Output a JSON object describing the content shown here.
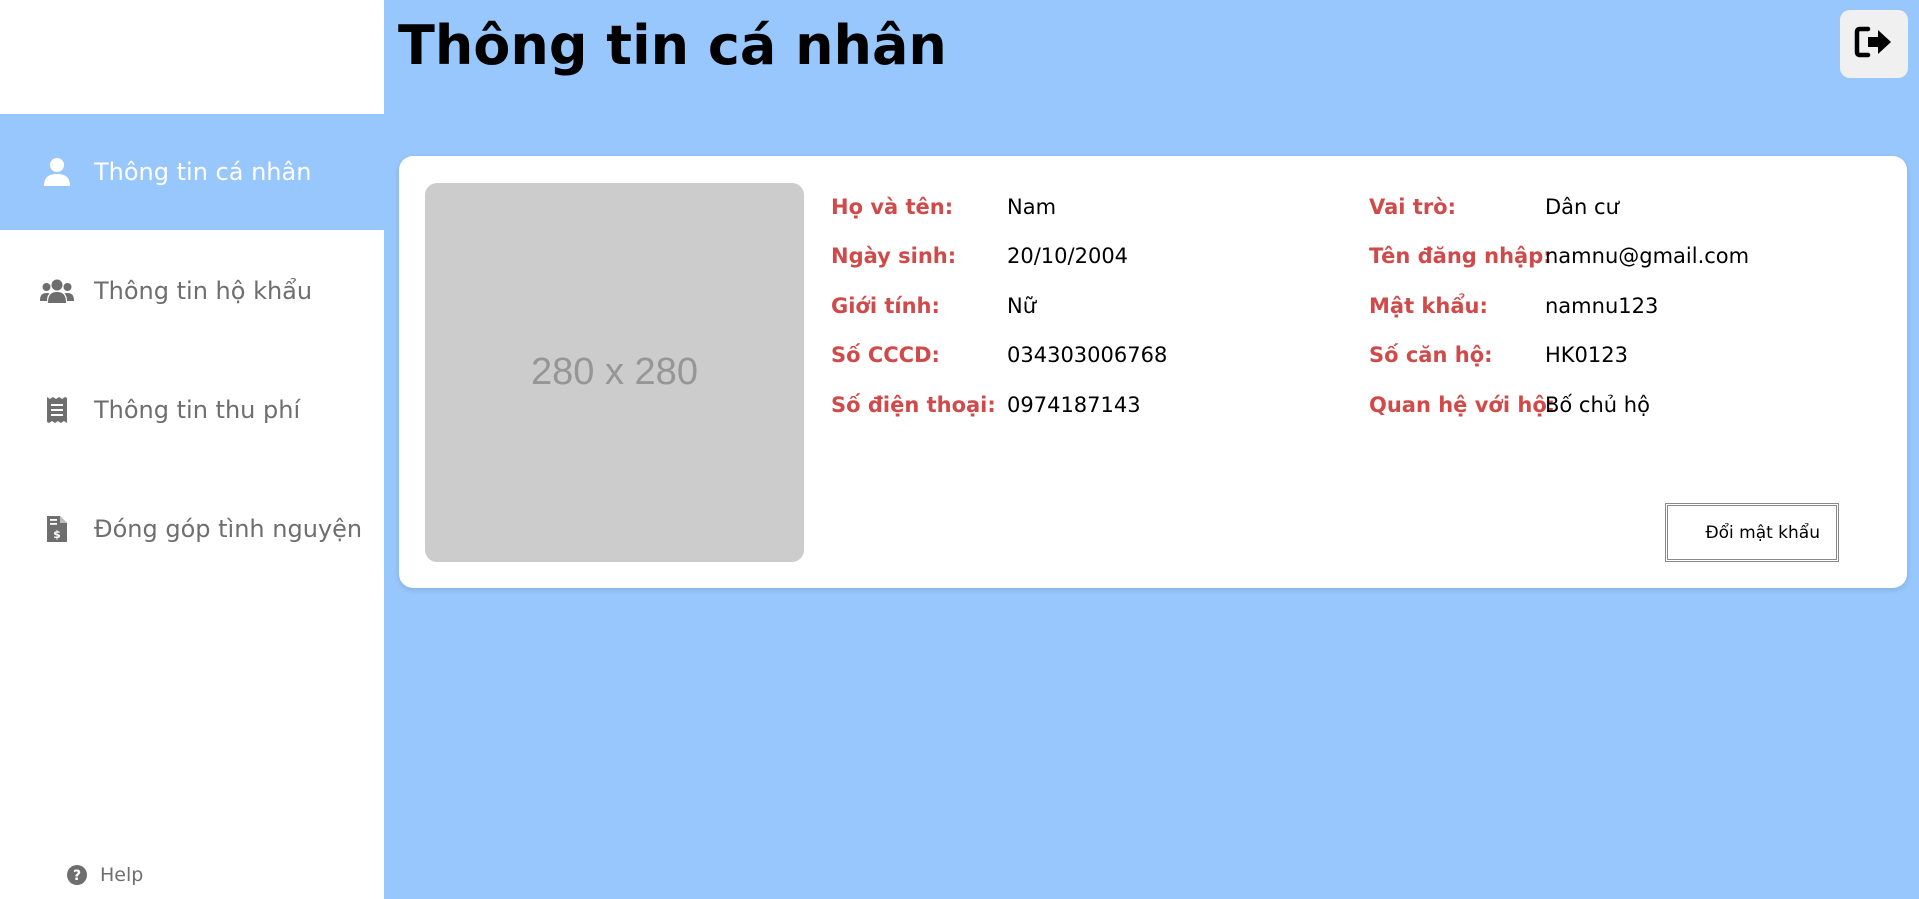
{
  "header": {
    "title": "Thông tin cá nhân"
  },
  "sidebar": {
    "items": [
      {
        "label": "Thông tin cá nhân",
        "icon": "user-icon",
        "active": true
      },
      {
        "label": "Thông tin hộ khẩu",
        "icon": "users-icon",
        "active": false
      },
      {
        "label": "Thông tin thu phí",
        "icon": "receipt-icon",
        "active": false
      },
      {
        "label": "Đóng góp tình nguyện",
        "icon": "invoice-dollar-icon",
        "active": false
      }
    ],
    "help_label": "Help"
  },
  "profile": {
    "avatar_placeholder": "280 x 280",
    "left_fields": [
      {
        "label": "Họ và tên:",
        "value": "Nam"
      },
      {
        "label": "Ngày sinh:",
        "value": "20/10/2004"
      },
      {
        "label": "Giới tính:",
        "value": "Nữ"
      },
      {
        "label": "Số CCCD:",
        "value": "034303006768"
      },
      {
        "label": "Số điện thoại:",
        "value": "0974187143"
      }
    ],
    "right_fields": [
      {
        "label": "Vai trò:",
        "value": "Dân cư"
      },
      {
        "label": "Tên đăng nhập:",
        "value": "namnu@gmail.com"
      },
      {
        "label": "Mật khẩu:",
        "value": "namnu123"
      },
      {
        "label": "Số căn hộ:",
        "value": "HK0123"
      },
      {
        "label": "Quan hệ với hộ:",
        "value": "Bố chủ hộ"
      }
    ],
    "change_password_label": "Đổi mật khẩu"
  },
  "colors": {
    "background": "#98c7fd",
    "label_red": "#d04a4a",
    "nav_text": "#6e6e6e"
  }
}
